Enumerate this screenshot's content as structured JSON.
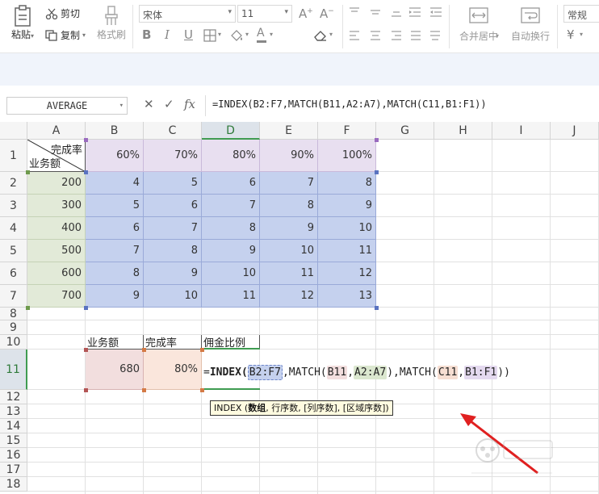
{
  "ribbon": {
    "paste_label": "粘贴",
    "cut_label": "剪切",
    "copy_label": "复制",
    "format_painter_label": "格式刷",
    "font_name": "宋体",
    "font_size": "11",
    "bold": "B",
    "italic": "I",
    "underline": "U",
    "merge_center_label": "合并居中",
    "wrap_text_label": "自动换行",
    "number_format": "常规",
    "currency_symbol": "¥"
  },
  "formula_bar": {
    "name_box": "AVERAGE",
    "cancel_symbol": "✕",
    "confirm_symbol": "✓",
    "fx_symbol": "fx",
    "formula": "=INDEX(B2:F7,MATCH(B11,A2:A7),MATCH(C11,B1:F1))"
  },
  "grid": {
    "columns": [
      "A",
      "B",
      "C",
      "D",
      "E",
      "F",
      "G",
      "H",
      "I",
      "J"
    ],
    "selected_column": "D",
    "rows": [
      "1",
      "2",
      "3",
      "4",
      "5",
      "6",
      "7",
      "8",
      "9",
      "10",
      "11",
      "12",
      "13",
      "14",
      "15",
      "16",
      "17",
      "18"
    ],
    "selected_row": "11",
    "a1_top": "完成率",
    "a1_bottom": "业务额",
    "header_rates": [
      "60%",
      "70%",
      "80%",
      "90%",
      "100%"
    ],
    "row_amounts": [
      "200",
      "300",
      "400",
      "500",
      "600",
      "700"
    ],
    "table_values": [
      [
        "4",
        "5",
        "6",
        "7",
        "8"
      ],
      [
        "5",
        "6",
        "7",
        "8",
        "9"
      ],
      [
        "6",
        "7",
        "8",
        "9",
        "10"
      ],
      [
        "7",
        "8",
        "9",
        "10",
        "11"
      ],
      [
        "8",
        "9",
        "10",
        "11",
        "12"
      ],
      [
        "9",
        "10",
        "11",
        "12",
        "13"
      ]
    ],
    "lookup_labels": [
      "业务额",
      "完成率",
      "佣金比例"
    ],
    "lookup_amount": "680",
    "lookup_rate": "80%"
  },
  "cell_formula": {
    "prefix": "=",
    "func": "INDEX",
    "open": "(",
    "ref1": "B2:F7",
    "sep1": ",MATCH(",
    "ref2": "B11",
    "comma": ",",
    "ref3": "A2:A7",
    "sep2": "),MATCH(",
    "ref4": "C11",
    "comma2": ",",
    "ref5": "B1:F1",
    "close": "))"
  },
  "tooltip": {
    "fn": "INDEX",
    "paren_open": " (",
    "arg_bold": "数组",
    "rest": ", 行序数, [列序数], [区域序数])"
  },
  "colors": {
    "selection_green": "#3f9c51",
    "arrow_red": "#e02020"
  }
}
